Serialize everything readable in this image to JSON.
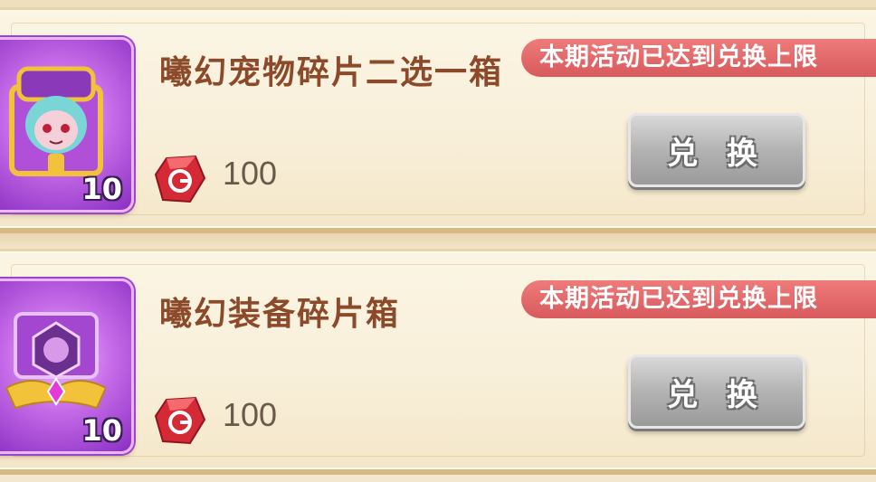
{
  "items": [
    {
      "title": "曦幻宠物碎片二选一箱",
      "count": "10",
      "price": "100",
      "limit_text": "本期活动已达到兑换上限",
      "button_label": "兑 换",
      "icon": "pet-shard-chest-icon"
    },
    {
      "title": "曦幻装备碎片箱",
      "count": "10",
      "price": "100",
      "limit_text": "本期活动已达到兑换上限",
      "button_label": "兑 换",
      "icon": "equipment-shard-chest-icon"
    }
  ],
  "currency_icon": "red-gem-icon",
  "colors": {
    "title": "#8c4a2a",
    "badge": "#e06a6b",
    "button_disabled": "#b3b3b3",
    "item_frame": "#c66be8"
  }
}
